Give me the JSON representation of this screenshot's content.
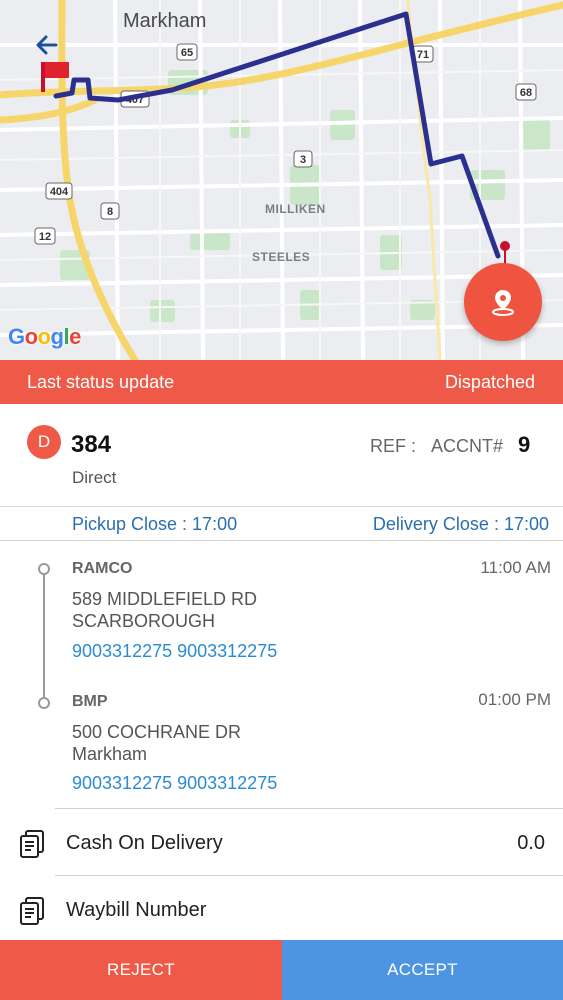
{
  "map": {
    "place_labels": {
      "markham": "Markham",
      "milliken": "MILLIKEN",
      "steeles": "STEELES"
    },
    "highway_shields": [
      "65",
      "407",
      "71",
      "68",
      "3",
      "404",
      "8",
      "12"
    ],
    "google_logo": "Google",
    "route_color": "#2b2f8f",
    "icons": {
      "back": "arrow-left-icon",
      "start_marker": "red-flag-icon",
      "end_marker": "red-pin-icon",
      "fab": "location-pin-icon"
    }
  },
  "status": {
    "label": "Last status update",
    "value": "Dispatched"
  },
  "order": {
    "badge": "D",
    "number": "384",
    "type": "Direct",
    "ref_label": "REF :",
    "accnt_label": "ACCNT#",
    "accnt_value": "9",
    "pickup_close": "Pickup Close : 17:00",
    "delivery_close": "Delivery Close : 17:00"
  },
  "stops": [
    {
      "name": "RAMCO",
      "time": "11:00 AM",
      "address_line1": "589 MIDDLEFIELD RD",
      "address_line2": "SCARBOROUGH",
      "phones": "9003312275 9003312275"
    },
    {
      "name": "BMP",
      "time": "01:00 PM",
      "address_line1": "500 COCHRANE DR",
      "address_line2": "Markham",
      "phones": "9003312275 9003312275"
    }
  ],
  "info": {
    "cod_label": "Cash On Delivery",
    "cod_value": "0.0",
    "waybill_label": "Waybill Number"
  },
  "actions": {
    "reject": "REJECT",
    "accept": "ACCEPT"
  },
  "colors": {
    "accent_red": "#ee5a47",
    "accept_blue": "#4d95e3",
    "link_blue": "#2a6fb0"
  }
}
